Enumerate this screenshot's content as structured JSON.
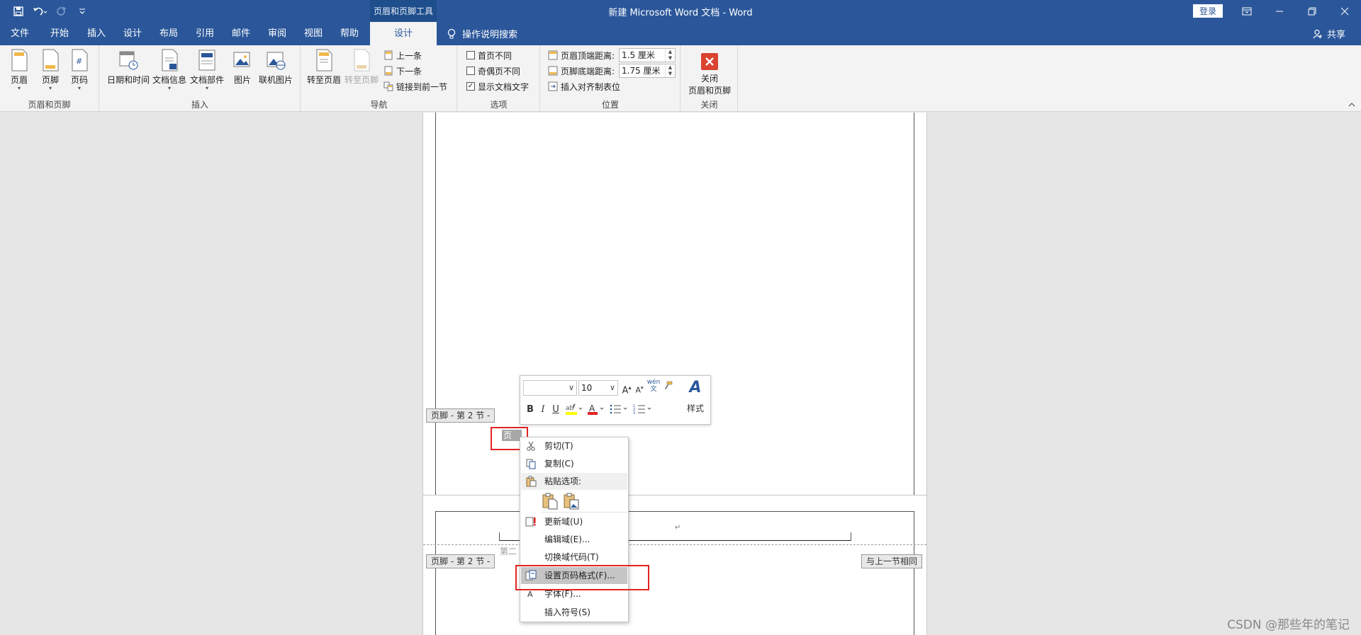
{
  "titlebar": {
    "document_title": "新建 Microsoft Word 文档  -  Word",
    "context_tool_label": "页眉和页脚工具",
    "login_label": "登录",
    "colors": {
      "titlebar_bg": "#2b579a"
    }
  },
  "tabs": [
    {
      "label": "文件"
    },
    {
      "label": "开始"
    },
    {
      "label": "插入"
    },
    {
      "label": "设计"
    },
    {
      "label": "布局"
    },
    {
      "label": "引用"
    },
    {
      "label": "邮件"
    },
    {
      "label": "审阅"
    },
    {
      "label": "视图"
    },
    {
      "label": "帮助"
    },
    {
      "label": "设计",
      "active": true
    }
  ],
  "tell_me": "操作说明搜索",
  "share": "共享",
  "ribbon": {
    "groups": {
      "header_footer": {
        "label": "页眉和页脚",
        "buttons": [
          {
            "label": "页眉"
          },
          {
            "label": "页脚"
          },
          {
            "label": "页码"
          }
        ]
      },
      "insert": {
        "label": "插入",
        "buttons": [
          {
            "label": "日期和时间"
          },
          {
            "label": "文档信息"
          },
          {
            "label": "文档部件"
          },
          {
            "label": "图片"
          },
          {
            "label": "联机图片"
          }
        ]
      },
      "navigation": {
        "label": "导航",
        "buttons": [
          {
            "label": "转至页眉"
          },
          {
            "label": "转至页脚"
          }
        ],
        "small": [
          {
            "label": "上一条"
          },
          {
            "label": "下一条"
          },
          {
            "label": "链接到前一节"
          }
        ]
      },
      "options": {
        "label": "选项",
        "checks": [
          {
            "label": "首页不同",
            "checked": false
          },
          {
            "label": "奇偶页不同",
            "checked": false
          },
          {
            "label": "显示文档文字",
            "checked": true
          }
        ]
      },
      "position": {
        "label": "位置",
        "header_top_label": "页眉顶端距离:",
        "header_top_value": "1.5 厘米",
        "footer_bottom_label": "页脚底端距离:",
        "footer_bottom_value": "1.75 厘米",
        "insert_align_tab": "插入对齐制表位"
      },
      "close": {
        "label": "关闭",
        "button_line1": "关闭",
        "button_line2": "页眉和页脚"
      }
    }
  },
  "document": {
    "footer_tag_1": "页脚 - 第 2 节 -",
    "footer_tag_2": "页脚 - 第 2 节 -",
    "same_as_previous": "与上一节相同",
    "selected_field_text": "页",
    "footer2_text": "第二",
    "return_mark": "↵"
  },
  "mini_toolbar": {
    "font_name": "",
    "font_size": "10",
    "styles_label": "样式"
  },
  "context_menu": {
    "items": [
      {
        "label": "剪切(T)",
        "icon": "scissors-icon"
      },
      {
        "label": "复制(C)",
        "icon": "copy-icon"
      },
      {
        "label": "粘贴选项:",
        "icon": "clipboard-icon"
      },
      {
        "label": "更新域(U)",
        "icon": "update-field-icon"
      },
      {
        "label": "编辑域(E)..."
      },
      {
        "label": "切换域代码(T)"
      },
      {
        "label": "设置页码格式(F)...",
        "icon": "page-number-format-icon",
        "highlighted": true
      },
      {
        "label": "字体(F)...",
        "icon": "font-icon"
      },
      {
        "label": "插入符号(S)"
      }
    ]
  },
  "watermark": "CSDN @那些年的笔记"
}
